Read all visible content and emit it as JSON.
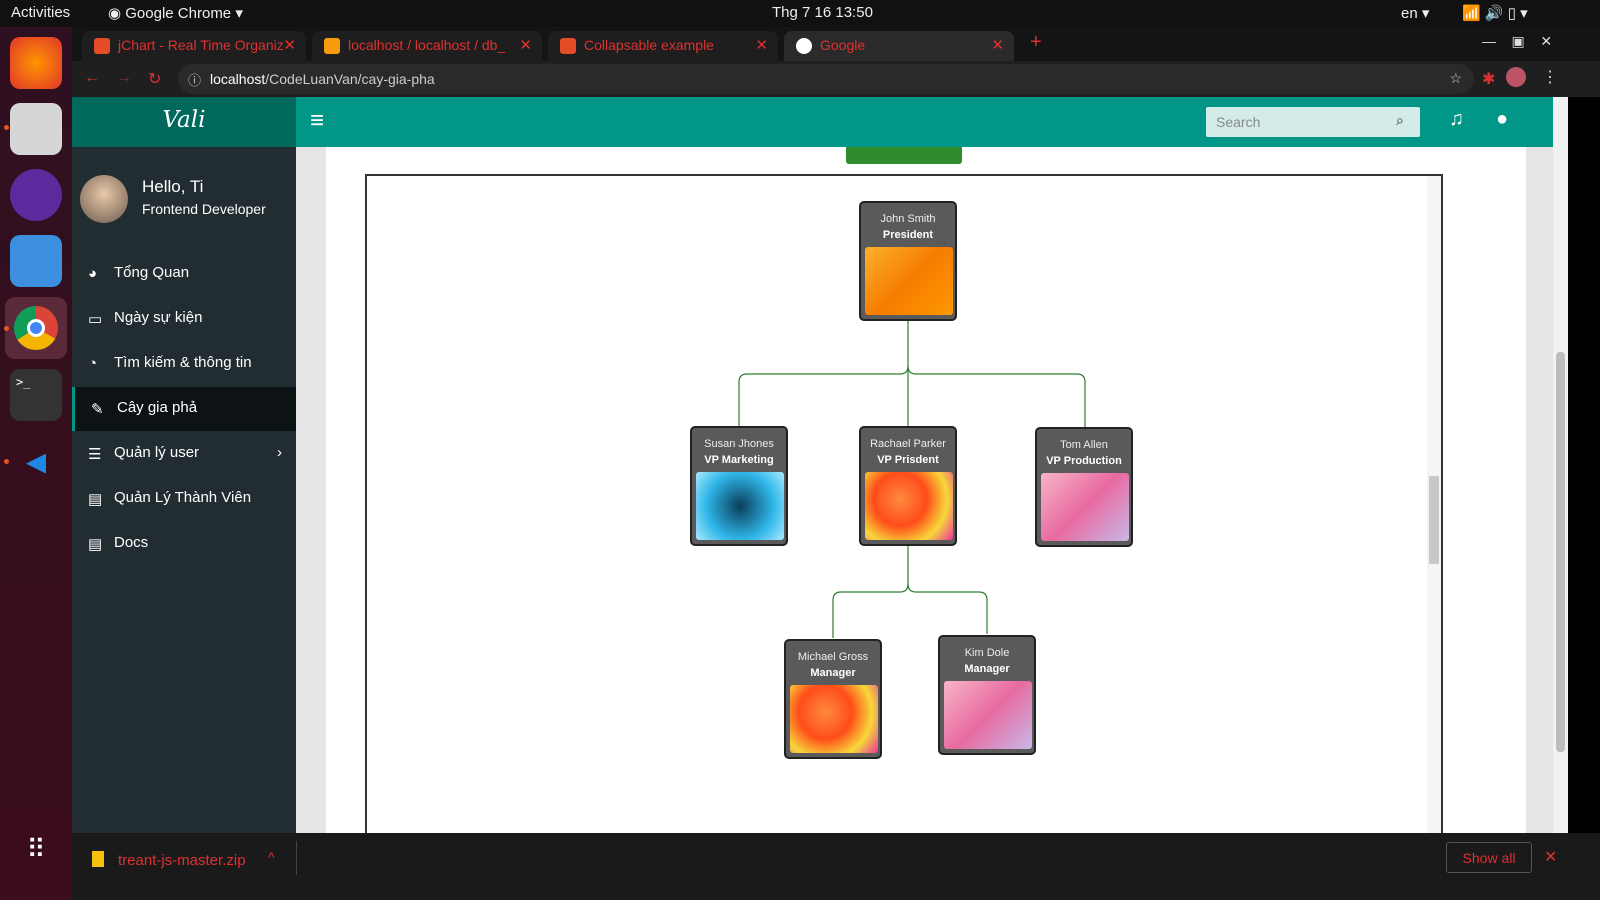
{
  "os": {
    "activities": "Activities",
    "app_menu": "Google Chrome",
    "clock": "Thg 7 16  13:50",
    "lang": "en"
  },
  "browser": {
    "tabs": [
      {
        "label": "jChart - Real Time Organiz"
      },
      {
        "label": "localhost / localhost / db_"
      },
      {
        "label": "Collapsable example"
      },
      {
        "label": "Google"
      }
    ],
    "url_host": "localhost",
    "url_path": "/CodeLuanVan/cay-gia-pha"
  },
  "app": {
    "brand": "Vali",
    "search_placeholder": "Search",
    "user": {
      "greeting": "Hello, Ti",
      "role": "Frontend Developer"
    },
    "menu": [
      {
        "label": "Tổng Quan"
      },
      {
        "label": "Ngày sự kiện"
      },
      {
        "label": "Tìm kiếm & thông tin"
      },
      {
        "label": "Cây gia phả"
      },
      {
        "label": "Quản lý user"
      },
      {
        "label": "Quản Lý Thành Viên"
      },
      {
        "label": "Docs"
      }
    ],
    "active_menu": "Cây gia phả"
  },
  "org_chart": {
    "nodes": [
      {
        "name": "John Smith",
        "title": "President",
        "parent": null
      },
      {
        "name": "Susan Jhones",
        "title": "VP Marketing",
        "parent": "John Smith"
      },
      {
        "name": "Rachael Parker",
        "title": "VP Prisdent",
        "parent": "John Smith"
      },
      {
        "name": "Tom Allen",
        "title": "VP Production",
        "parent": "John Smith"
      },
      {
        "name": "Michael Gross",
        "title": "Manager",
        "parent": "Rachael Parker"
      },
      {
        "name": "Kim Dole",
        "title": "Manager",
        "parent": "Rachael Parker"
      }
    ]
  },
  "downloads": {
    "file": "treant-js-master.zip",
    "show_all": "Show all"
  },
  "colors": {
    "header": "#009688",
    "brand": "#00695c",
    "sidebar": "#222d32",
    "connector": "#2e7d32"
  }
}
